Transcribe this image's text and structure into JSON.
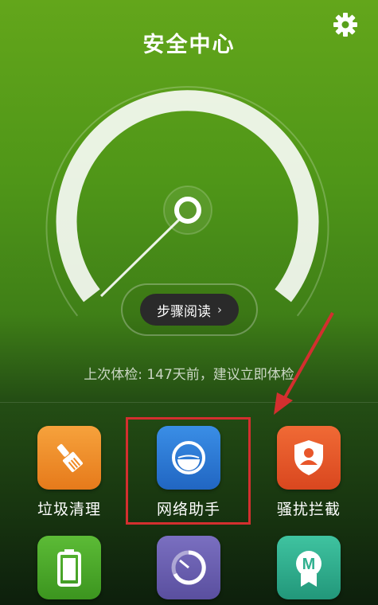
{
  "header": {
    "title": "安全中心"
  },
  "gauge": {
    "read_button_label": "步骤阅读",
    "chevron": "›"
  },
  "status": {
    "last_check": "上次体检: 147天前，建议立即体检"
  },
  "apps": [
    {
      "label": "垃圾清理",
      "icon": "broom-icon",
      "color": "#f08a24"
    },
    {
      "label": "网络助手",
      "icon": "network-icon",
      "color": "#2b78d4"
    },
    {
      "label": "骚扰拦截",
      "icon": "shield-user-icon",
      "color": "#e8562a"
    },
    {
      "label": "",
      "icon": "battery-icon",
      "color": "#49a52a"
    },
    {
      "label": "",
      "icon": "speedometer-icon",
      "color": "#6a5fb0"
    },
    {
      "label": "",
      "icon": "m-badge-icon",
      "color": "#2fb08f"
    }
  ],
  "colors": {
    "highlight": "#d32f2f",
    "annotation_arrow": "#d32f2f"
  }
}
